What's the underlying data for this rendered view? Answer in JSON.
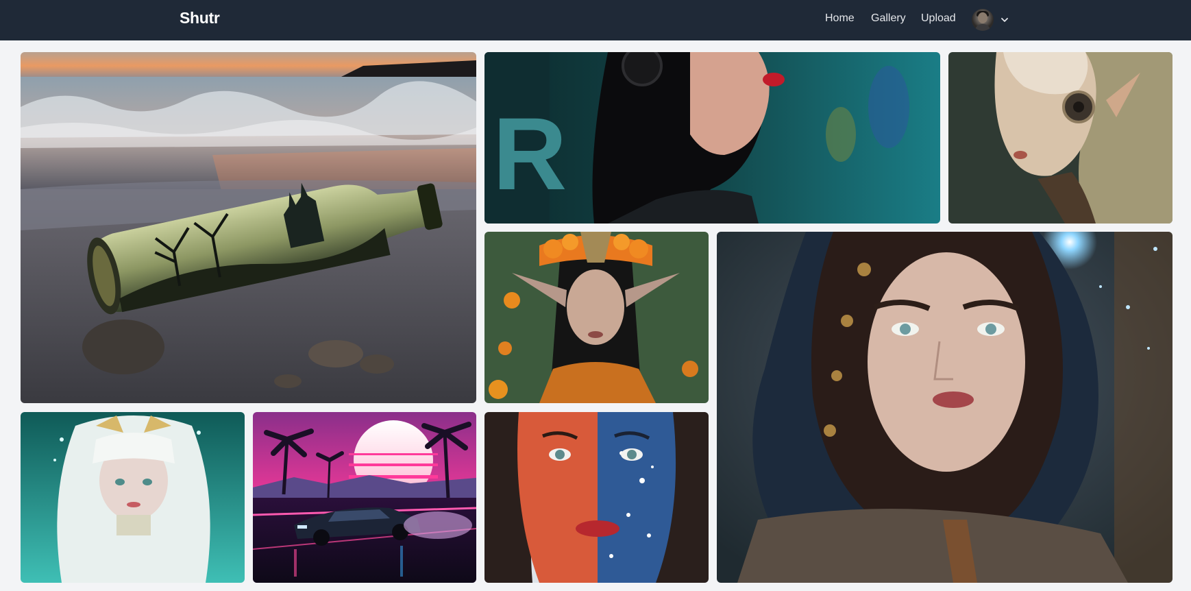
{
  "app": {
    "brand": "Shutr"
  },
  "nav": {
    "home": "Home",
    "gallery": "Gallery",
    "upload": "Upload"
  },
  "user_menu": {
    "avatar_icon": "user-avatar-icon",
    "toggle_icon": "chevron-down-icon"
  },
  "gallery": {
    "images": [
      {
        "subject": "bottle-castle-beach"
      },
      {
        "subject": "woman-teal-wall"
      },
      {
        "subject": "cyborg-elf"
      },
      {
        "subject": "elf-flower-crown"
      },
      {
        "subject": "hooded-woman"
      },
      {
        "subject": "white-hair-underwater"
      },
      {
        "subject": "synthwave-car"
      },
      {
        "subject": "split-face-paint"
      }
    ]
  },
  "colors": {
    "navbar_bg": "#1f2937",
    "page_bg": "#f3f4f6",
    "nav_text": "#e5e7eb"
  }
}
